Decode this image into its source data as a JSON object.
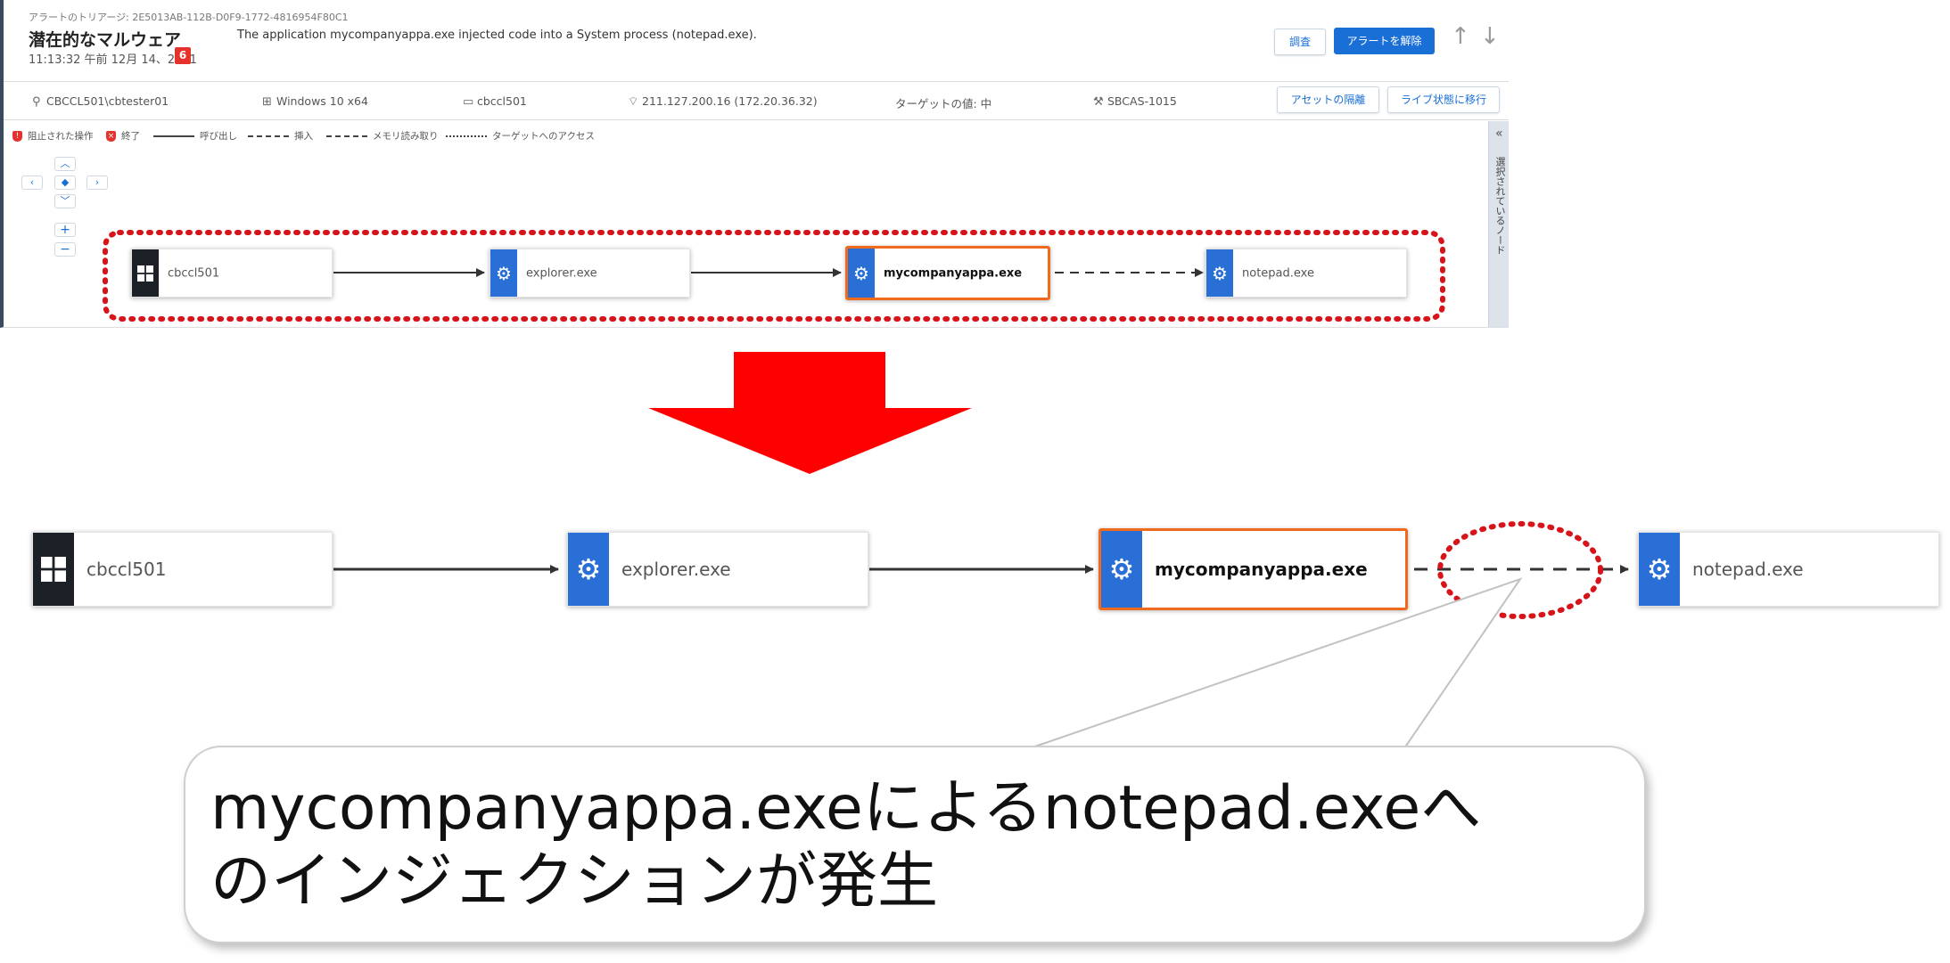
{
  "header": {
    "breadcrumb": "アラートのトリアージ: 2E5013AB-112B-D0F9-1772-4816954F80C1",
    "title": "潜在的なマルウェア",
    "timestamp": "11:13:32 午前 12月 14、2021",
    "severity": "6",
    "description": "The application mycompanyappa.exe injected code into a System process (notepad.exe).",
    "investigate_label": "調査",
    "dismiss_label": "アラートを解除"
  },
  "info": {
    "user": "CBCCL501\\cbtester01",
    "os": "Windows 10 x64",
    "device": "cbccl501",
    "ip": "211.127.200.16 (172.20.36.32)",
    "target_value": "ターゲットの値: 中",
    "policy": "SBCAS-1015",
    "quarantine_label": "アセットの隔離",
    "go_live_label": "ライブ状態に移行"
  },
  "legend": {
    "blocked": "阻止された操作",
    "terminated": "終了",
    "call": "呼び出し",
    "inject": "挿入",
    "memory_read": "メモリ読み取り",
    "target_access": "ターゲットへのアクセス"
  },
  "side_panel": {
    "label": "選択されているノード"
  },
  "process_tree": {
    "nodes": [
      {
        "label": "cbccl501",
        "icon": "windows-icon"
      },
      {
        "label": "explorer.exe",
        "icon": "gear-icon"
      },
      {
        "label": "mycompanyappa.exe",
        "icon": "gear-icon",
        "selected": true
      },
      {
        "label": "notepad.exe",
        "icon": "gear-icon"
      }
    ],
    "edges": [
      "call",
      "call",
      "inject"
    ]
  },
  "callout": {
    "line1": "mycompanyappa.exeによるnotepad.exeへ",
    "line2": "のインジェクションが発生"
  },
  "colors": {
    "accent": "#1a6fd6",
    "selected_border": "#ef6a1d",
    "highlight_red": "#d7141a",
    "arrow_red": "#ff0000"
  }
}
